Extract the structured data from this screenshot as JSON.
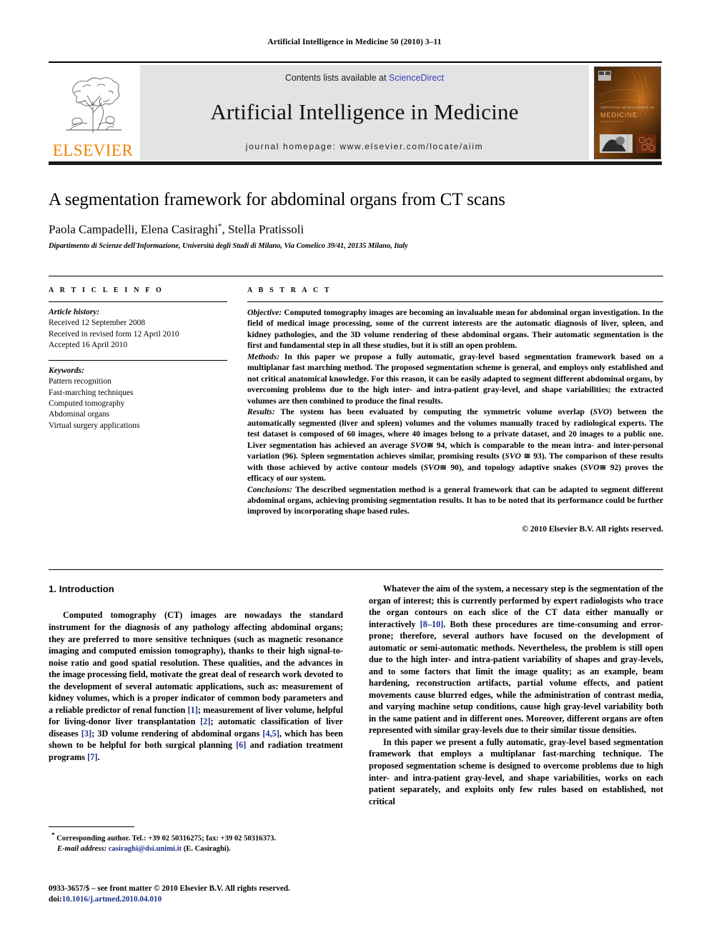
{
  "running_head": "Artificial Intelligence in Medicine 50 (2010) 3–11",
  "masthead": {
    "publisher_logo_text": "ELSEVIER",
    "contents_prefix": "Contents lists available at ",
    "contents_link": "ScienceDirect",
    "journal_title": "Artificial Intelligence in Medicine",
    "homepage": "journal homepage: www.elsevier.com/locate/aiim",
    "cover_title_small": "ARTIFICIAL INTELLIGENCE IN",
    "cover_title_big": "MEDICINE"
  },
  "article": {
    "title": "A segmentation framework for abdominal organs from CT scans",
    "authors": "Paola Campadelli, Elena Casiraghi",
    "authors_tail": ", Stella Pratissoli",
    "corresponding_marker": "*",
    "affiliation": "Dipartimento di Scienze dell'Informazione, Università degli Studi di Milano, Via Comelico 39/41, 20135 Milano, Italy"
  },
  "article_info": {
    "heading": "A R T I C L E   I N F O",
    "history_label": "Article history:",
    "history": [
      "Received 12 September 2008",
      "Received in revised form 12 April 2010",
      "Accepted 16 April 2010"
    ],
    "keywords_label": "Keywords:",
    "keywords": [
      "Pattern recognition",
      "Fast-marching techniques",
      "Computed tomography",
      "Abdominal organs",
      "Virtual surgery applications"
    ]
  },
  "abstract": {
    "heading": "A B S T R A C T",
    "objective_label": "Objective:",
    "objective_text": " Computed tomography images are becoming an invaluable mean for abdominal organ investigation. In the field of medical image processing, some of the current interests are the automatic diagnosis of liver, spleen, and kidney pathologies, and the 3D volume rendering of these abdominal organs. Their automatic segmentation is the first and fundamental step in all these studies, but it is still an open problem.",
    "methods_label": "Methods:",
    "methods_text": "  In this paper we propose a fully automatic, gray-level based segmentation framework based on a multiplanar fast marching method. The proposed segmentation scheme is general, and employs only established and not critical anatomical knowledge. For this reason, it can be easily adapted to segment different abdominal organs, by overcoming problems due to the high inter- and intra-patient gray-level, and shape variabilities; the extracted volumes are then combined to produce the final results.",
    "results_label": "Results:",
    "results_part1": "  The system has been evaluated by computing the symmetric volume overlap (",
    "results_svo1": "SVO",
    "results_part2": ") between the automatically segmented (liver and spleen) volumes and the volumes manually traced by radiological experts. The test dataset is composed of 60 images, where 40 images belong to a private dataset, and 20 images to a public one. Liver segmentation has achieved an average ",
    "results_svo2": "SVO",
    "results_part3": "≅ 94, which is comparable to the mean intra- and inter-personal variation (96). Spleen segmentation achieves similar, promising results (",
    "results_svo3": "SVO",
    "results_part4": " ≅ 93). The comparison of these results with those achieved by active contour models (",
    "results_svo4": "SVO",
    "results_part5": "≅ 90), and topology adaptive snakes (",
    "results_svo5": "SVO",
    "results_part6": "≅ 92) proves the efficacy of our system.",
    "conclusions_label": "Conclusions:",
    "conclusions_text": " The described segmentation method is a general framework that can be adapted to segment different abdominal organs, achieving promising segmentation results. It has to be noted that its performance could be further improved by incorporating shape based rules.",
    "copyright": "© 2010 Elsevier B.V. All rights reserved."
  },
  "body": {
    "section_heading": "1. Introduction",
    "left_p1_a": "Computed tomography (CT) images are nowadays the standard instrument for the diagnosis of any pathology affecting abdominal organs; they are preferred to more sensitive techniques (such as magnetic resonance imaging and computed emission tomography), thanks to their high signal-to-noise ratio and good spatial resolution. These qualities, and the advances in the image processing field, motivate the great deal of research work devoted to the development of several automatic applications, such as: measurement of kidney volumes, which is a proper indicator of common body parameters and a reliable predictor of renal function ",
    "ref1": "[1]",
    "left_p1_b": "; measurement of liver volume, helpful for living-donor liver transplantation ",
    "ref2": "[2]",
    "left_p1_c": "; automatic classification of liver diseases ",
    "ref3": "[3]",
    "left_p1_d": "; 3D volume rendering of abdominal organs ",
    "ref45": "[4,5]",
    "left_p1_e": ", which has been shown to be helpful for both surgical planning ",
    "ref6": "[6]",
    "left_p1_f": " and radiation treatment programs ",
    "ref7": "[7]",
    "left_p1_g": ".",
    "right_p1_a": "Whatever the aim of the system, a necessary step is the segmentation of the organ of interest; this is currently performed by expert radiologists who trace the organ contours on each slice of the CT data either manually or interactively ",
    "ref810": "[8–10]",
    "right_p1_b": ". Both these procedures are time-consuming and error-prone; therefore, several authors have focused on the development of automatic or semi-automatic methods. Nevertheless, the problem is still open due to the high inter- and intra-patient variability of shapes and gray-levels, and to some factors that limit the image quality; as an example, beam hardening, reconstruction artifacts, partial volume effects, and patient movements cause blurred edges, while the administration of contrast media, and varying machine setup conditions, cause high gray-level variability both in the same patient and in different ones. Moreover, different organs are often represented with similar gray-levels due to their similar tissue densities.",
    "right_p2": "In this paper we present a fully automatic, gray-level based segmentation framework that employs a multiplanar fast-marching technique. The proposed segmentation scheme is designed to overcome problems due to high inter- and intra-patient gray-level, and shape variabilities, works on each patient separately, and exploits only few rules based on established, not critical"
  },
  "footnotes": {
    "corresponding": "Corresponding author. Tel.: +39 02 50316275; fax: +39 02 50316373.",
    "email_label": "E-mail address:",
    "email": "casiraghi@dsi.unimi.it",
    "email_tail": " (E. Casiraghi).",
    "issn_line": "0933-3657/$ – see front matter © 2010 Elsevier B.V. All rights reserved.",
    "doi_label": "doi:",
    "doi": "10.1016/j.artmed.2010.04.010"
  },
  "colors": {
    "elsevier_orange": "#F08000",
    "link_blue": "#1b2f8c",
    "sciencedirect_blue": "#3b3bbf",
    "masthead_gray": "#e3e3e3"
  }
}
